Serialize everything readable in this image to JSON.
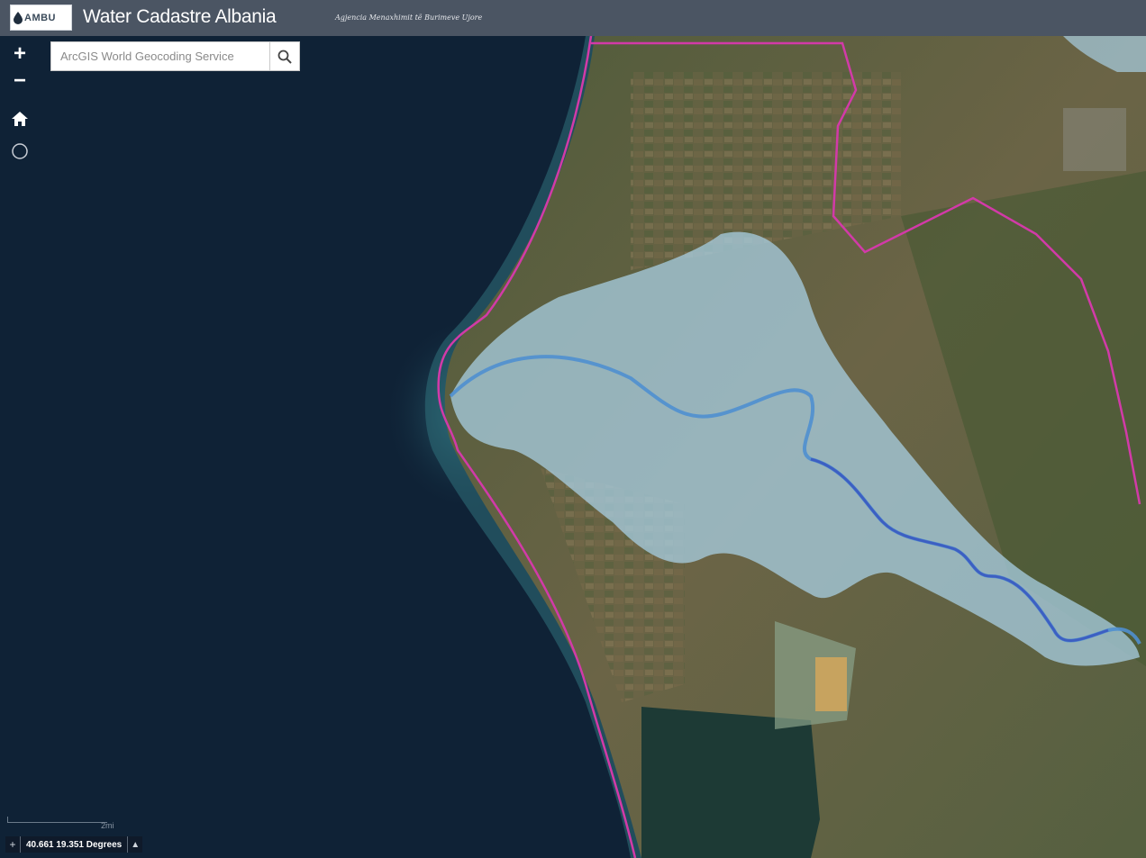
{
  "header": {
    "logo_text": "AMBU",
    "title": "Water Cadastre Albania",
    "subtitle": "Agjencia Menaxhimit të Burimeve Ujore"
  },
  "search": {
    "placeholder": "ArcGIS World Geocoding Service"
  },
  "map_controls": {
    "zoom_in": "+",
    "zoom_out": "−"
  },
  "scale": {
    "label": "2mi"
  },
  "coordinates": {
    "text": "40.661 19.351 Degrees"
  },
  "colors": {
    "header_bg": "#4b5563",
    "sea": "#0f2236",
    "boundary": "#d23aa8",
    "flood_zone": "#a8cfe3",
    "river": "#3d5fc2"
  },
  "icons": [
    "home-icon",
    "locate-icon",
    "search-icon",
    "crosshair-icon",
    "chevron-up-icon"
  ]
}
